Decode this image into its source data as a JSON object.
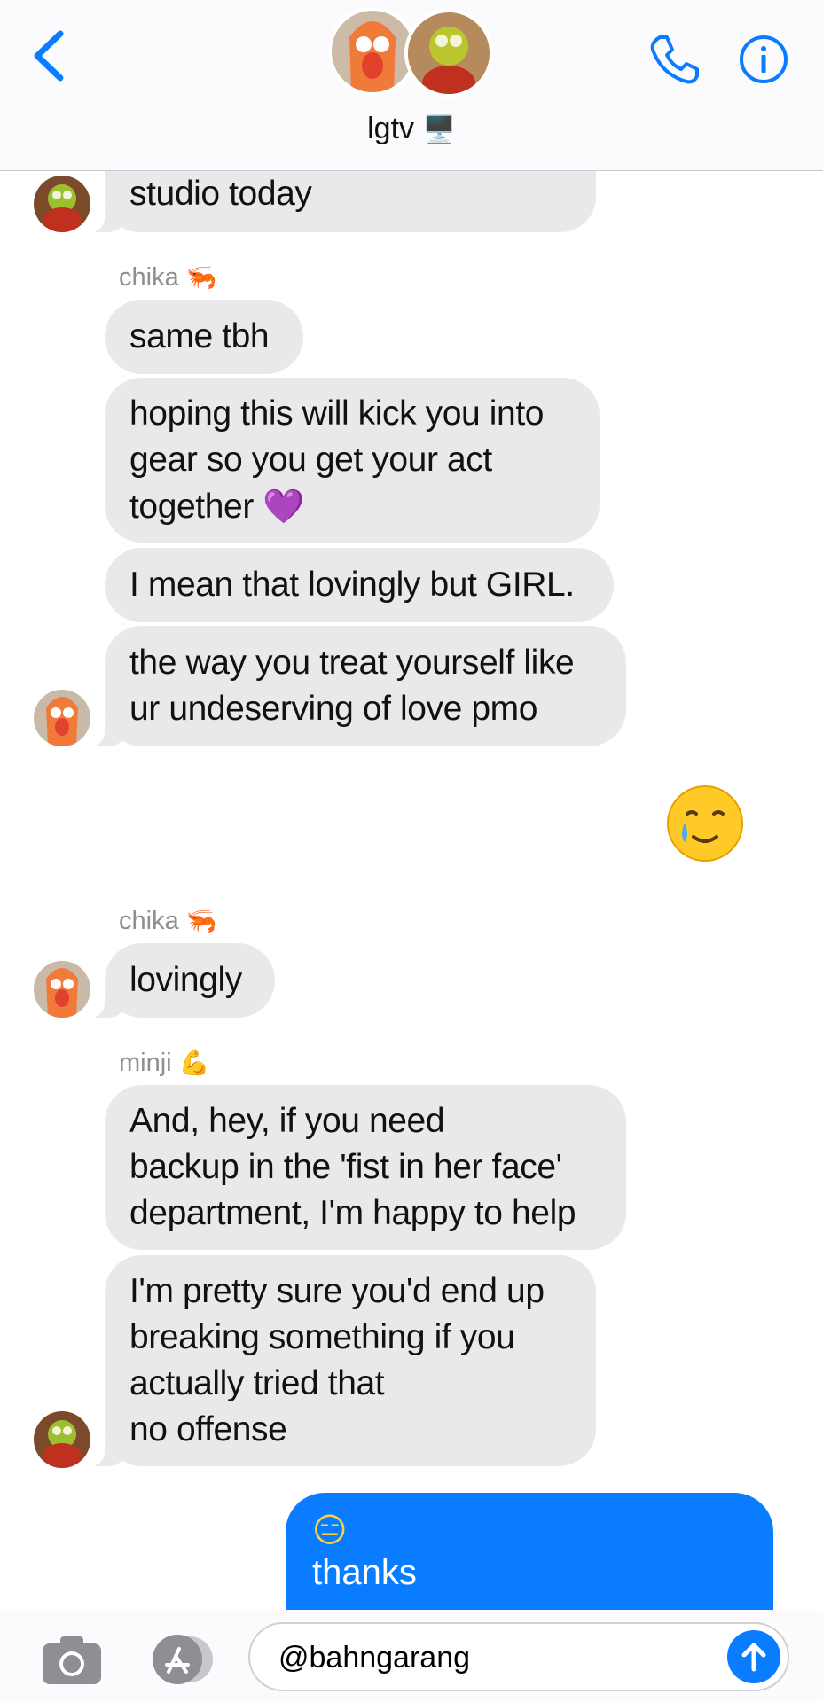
{
  "header": {
    "title": "lgtv",
    "title_emoji": "🖥️"
  },
  "messages": [
    {
      "id": "m1",
      "text": "studio today"
    },
    {
      "id": "m2",
      "sender": "chika",
      "sender_emoji": "🦐",
      "text": "same tbh"
    },
    {
      "id": "m3",
      "lines": [
        "hoping this will kick you into",
        "gear so you get your act",
        "together"
      ],
      "emoji": "💜"
    },
    {
      "id": "m4",
      "text": "I mean that lovingly but GIRL."
    },
    {
      "id": "m5",
      "lines": [
        "the way you treat yourself like",
        "ur undeserving of love pmo"
      ]
    },
    {
      "id": "m6",
      "sender": "chika",
      "sender_emoji": "🦐",
      "text": "lovingly"
    },
    {
      "id": "m7",
      "sender": "minji",
      "sender_emoji": "💪",
      "lines": [
        "And, hey, if you need",
        "backup in the 'fist in her face'",
        "department, I'm happy to help"
      ]
    },
    {
      "id": "m8",
      "lines": [
        "I'm pretty sure you'd end up",
        "breaking something if you",
        "actually tried that",
        "no offense"
      ]
    }
  ],
  "reaction": {
    "icon": "crying-smile-emoji"
  },
  "sent": {
    "emoji": "😑",
    "text": "thanks"
  },
  "composer": {
    "input_value": "@bahngarang"
  },
  "colors": {
    "accent": "#0a7cff",
    "bubble_gray": "#e9e9eb",
    "sender_gray": "#8e8e93"
  }
}
